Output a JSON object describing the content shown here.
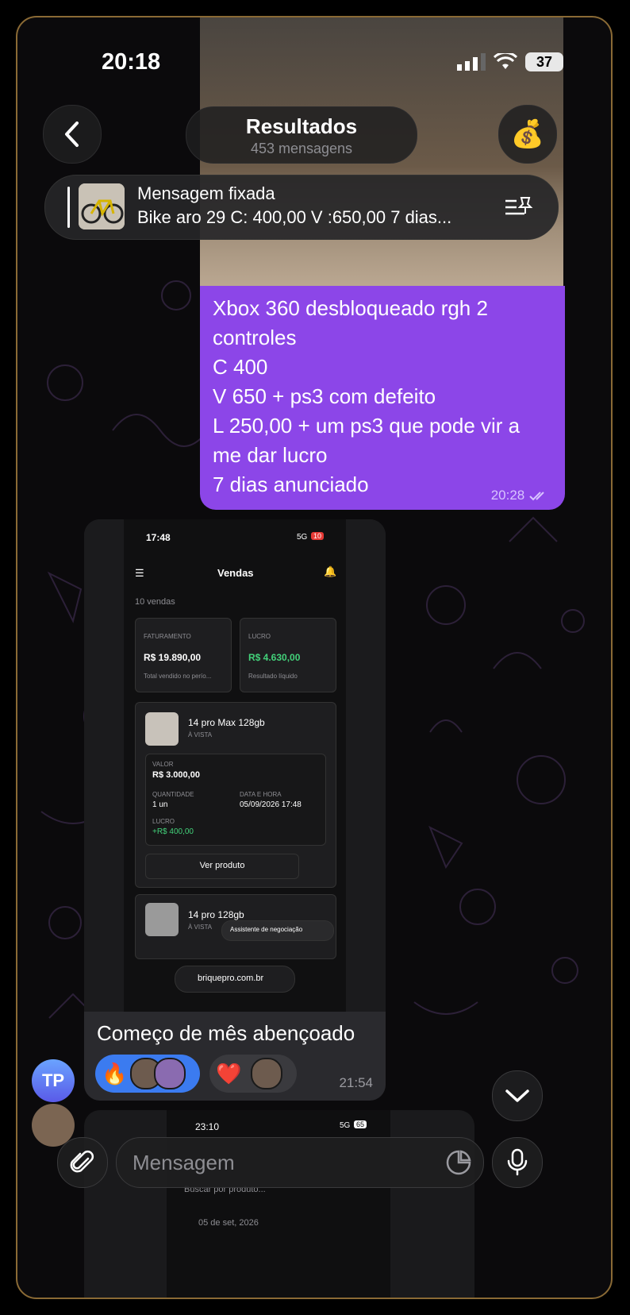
{
  "status": {
    "time": "20:18",
    "battery": "37"
  },
  "header": {
    "title": "Resultados",
    "subtitle": "453 mensagens",
    "avatar_emoji": "💰"
  },
  "pinned": {
    "title": "Mensagem fixada",
    "text": "Bike aro 29 C: 400,00 V :650,00 7 dias..."
  },
  "outgoing": {
    "text": "Xbox 360 desbloqueado rgh 2\ncontroles\nC 400\nV 650 + ps3 com defeito\nL 250,00 + um ps3 que pode vir a\nme dar lucro\n7 dias anunciado",
    "time": "20:28"
  },
  "incoming": {
    "screenshot": {
      "status_time": "17:48",
      "network": "5G",
      "battery": "10",
      "title": "Vendas",
      "count": "10 vendas",
      "faturamento_label": "FATURAMENTO",
      "faturamento_value": "R$ 19.890,00",
      "faturamento_sub": "Total vendido no perío...",
      "lucro_label": "LUCRO",
      "lucro_value": "R$ 4.630,00",
      "lucro_sub": "Resultado líquido",
      "item1_title": "14 pro Max 128gb",
      "item1_sub": "À VISTA",
      "valor_label": "VALOR",
      "valor_value": "R$ 3.000,00",
      "qtd_label": "QUANTIDADE",
      "qtd_value": "1 un",
      "data_label": "DATA E HORA",
      "data_value": "05/09/2026 17:48",
      "lucro_item_label": "LUCRO",
      "lucro_item_value": "+R$ 400,00",
      "ver_produto": "Ver produto",
      "item2_title": "14 pro 128gb",
      "item2_sub": "À VISTA",
      "assistente": "Assistente de negociação",
      "url": "briquepro.com.br"
    },
    "caption": "Começo de mês abençoado",
    "reaction1": "🔥",
    "reaction2": "❤️",
    "time": "21:54"
  },
  "sender": {
    "initials": "TP"
  },
  "next_shot": {
    "status_time": "23:10",
    "network": "5G",
    "battery": "65",
    "search": "Buscar por produto...",
    "date": "05 de set, 2026"
  },
  "composer": {
    "placeholder": "Mensagem"
  }
}
